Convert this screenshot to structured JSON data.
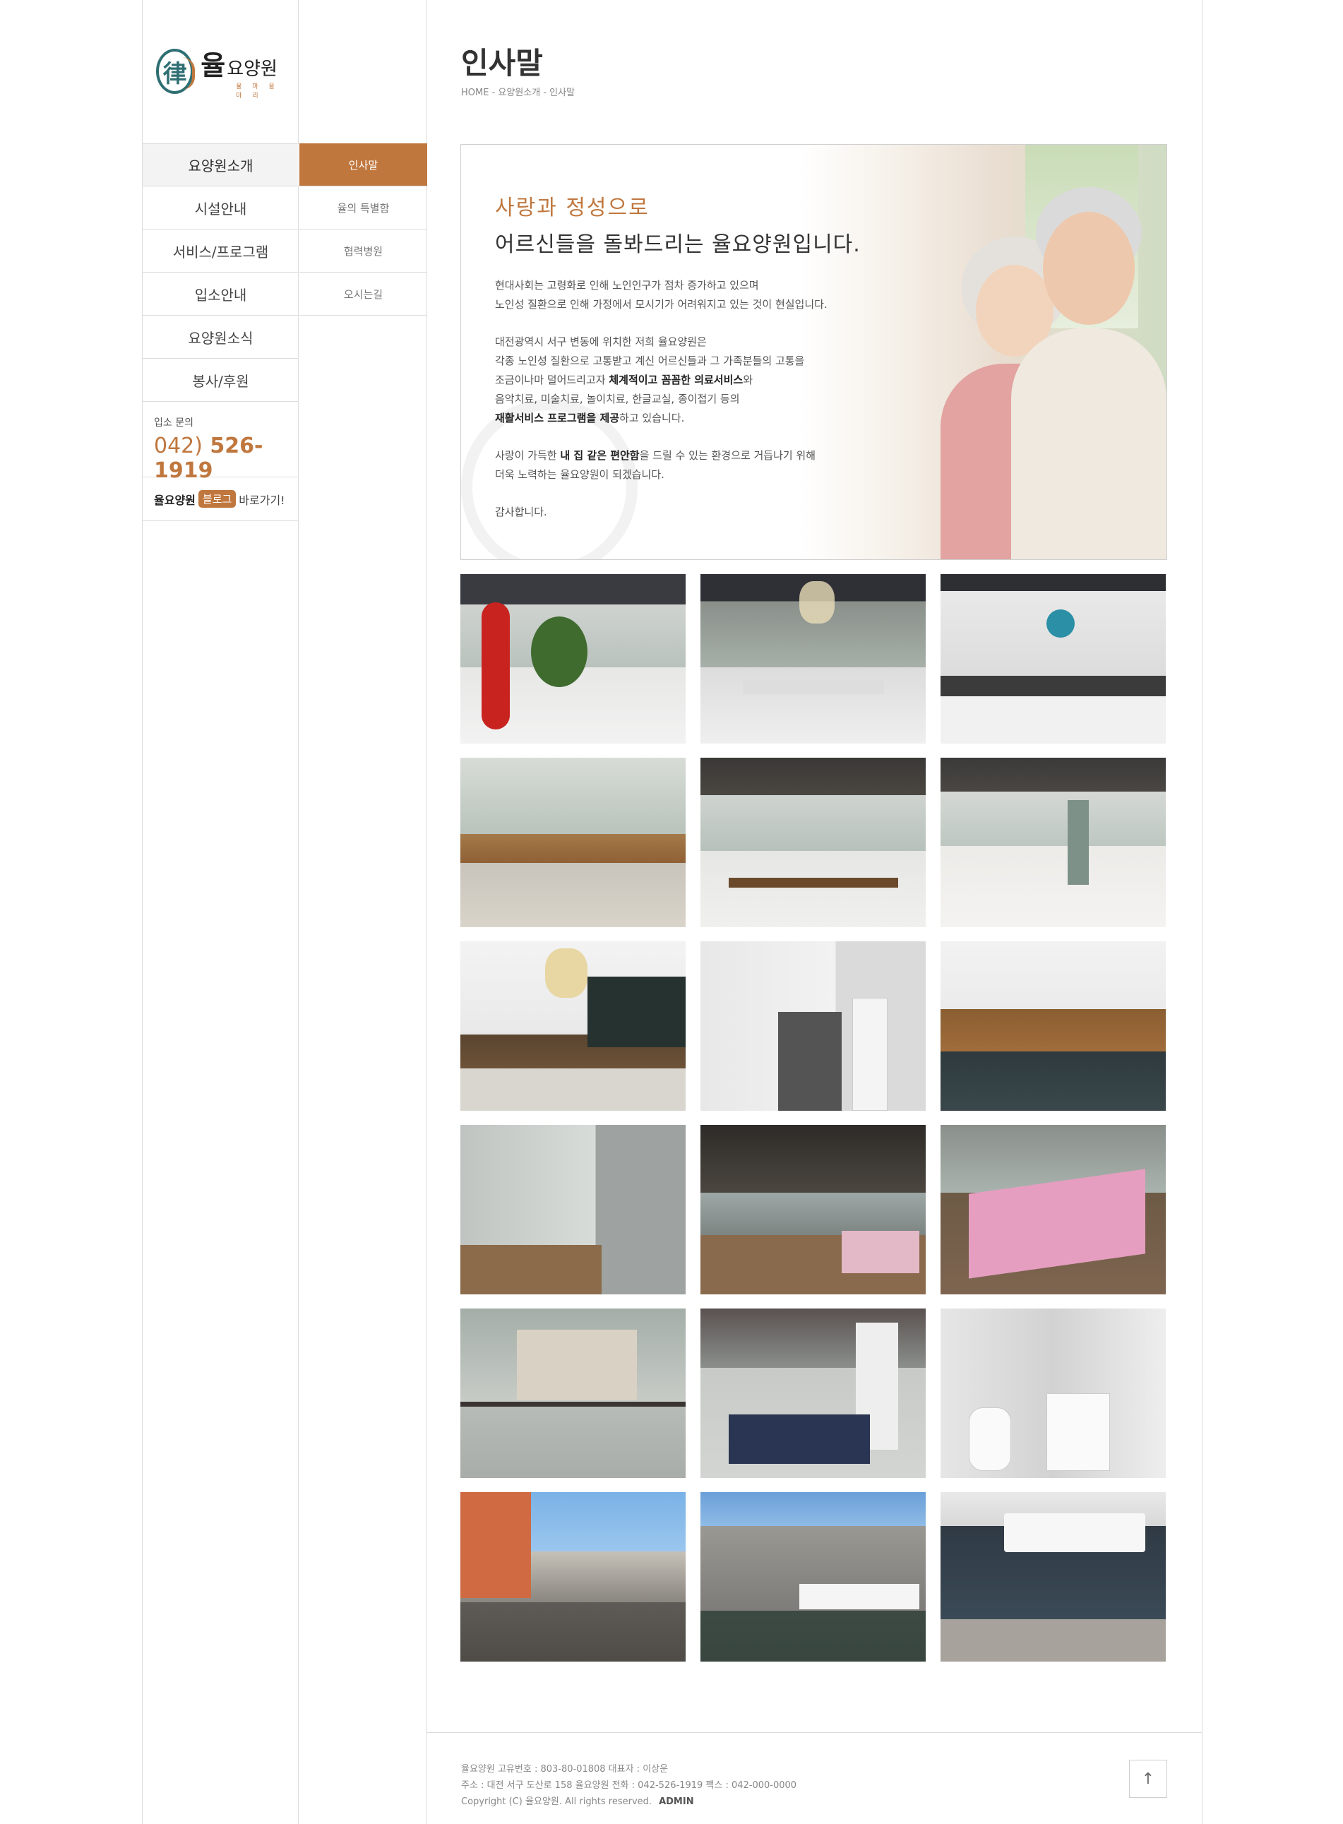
{
  "logo": {
    "seal": "律",
    "name_big": "율",
    "name_small": "요양원",
    "sub": "율 마 을 마 리"
  },
  "nav": {
    "items": [
      "요양원소개",
      "시설안내",
      "서비스/프로그램",
      "입소안내",
      "요양원소식",
      "봉사/후원"
    ],
    "active_index": 0
  },
  "contact": {
    "label": "입소 문의",
    "area": "042)",
    "number": "526-1919"
  },
  "blog": {
    "prefix": "율요양원",
    "badge": "블로그",
    "suffix": "바로가기!"
  },
  "subnav": {
    "items": [
      "인사말",
      "율의 특별함",
      "협력병원",
      "오시는길"
    ],
    "active_index": 0
  },
  "page": {
    "title": "인사말",
    "breadcrumb": "HOME - 요양원소개 - 인사말"
  },
  "hero": {
    "heading1": "사랑과 정성으로",
    "heading2": "어르신들을 돌봐드리는 율요양원입니다.",
    "p1_l1": "현대사회는 고령화로 인해 노인인구가 점차 증가하고 있으며",
    "p1_l2": "노인성 질환으로 인해 가정에서 모시기가 어려워지고 있는 것이 현실입니다.",
    "p2_l1": "대전광역시 서구 변동에 위치한 저희 율요양원은",
    "p2_l2": "각종 노인성 질환으로 고통받고 계신 어르신들과 그 가족분들의 고통을",
    "p2_l3a": "조금이나마 덜어드리고자 ",
    "p2_l3b": "체계적이고 꼼꼼한 의료서비스",
    "p2_l3c": "와",
    "p2_l4": "음악치료, 미술치료, 놀이치료, 한글교실, 종이접기 등의",
    "p2_l5a": "재활서비스 프로그램을 제공",
    "p2_l5b": "하고 있습니다.",
    "p3_l1a": "사랑이 가득한 ",
    "p3_l1b": "내 집 같은 편안함",
    "p3_l1c": "을 드릴 수 있는 환경으로 거듭나기 위해",
    "p3_l2": "더욱 노력하는 율요양원이 되겠습니다.",
    "p4": "감사합니다."
  },
  "gallery": [
    {
      "name": "lobby-red-lamp"
    },
    {
      "name": "lobby-chandelier"
    },
    {
      "name": "information-desk"
    },
    {
      "name": "lounge-wood-table"
    },
    {
      "name": "dining-hall"
    },
    {
      "name": "common-room"
    },
    {
      "name": "dining-room-chandelier"
    },
    {
      "name": "sink-area"
    },
    {
      "name": "dining-tables"
    },
    {
      "name": "hallway-door"
    },
    {
      "name": "bedroom-window"
    },
    {
      "name": "bedroom-pink-beds"
    },
    {
      "name": "bedroom-city-view"
    },
    {
      "name": "bedroom-cabinet"
    },
    {
      "name": "bathroom"
    },
    {
      "name": "parking-lot"
    },
    {
      "name": "building-exterior"
    },
    {
      "name": "building-entrance"
    }
  ],
  "footer": {
    "line1": "율요양원   고유번호 : 803-80-01808   대표자 : 이상운",
    "line2": "주소 : 대전 서구 도산로 158 율요양원   전화 : 042-526-1919   팩스 : 042-000-0000",
    "line3": "Copyright (C) 율요양원. All rights reserved.",
    "admin": "ADMIN",
    "top_button": "↑"
  },
  "colors": {
    "accent": "#c0773e",
    "seal": "#2f6f73",
    "border": "#dcdcdc"
  }
}
